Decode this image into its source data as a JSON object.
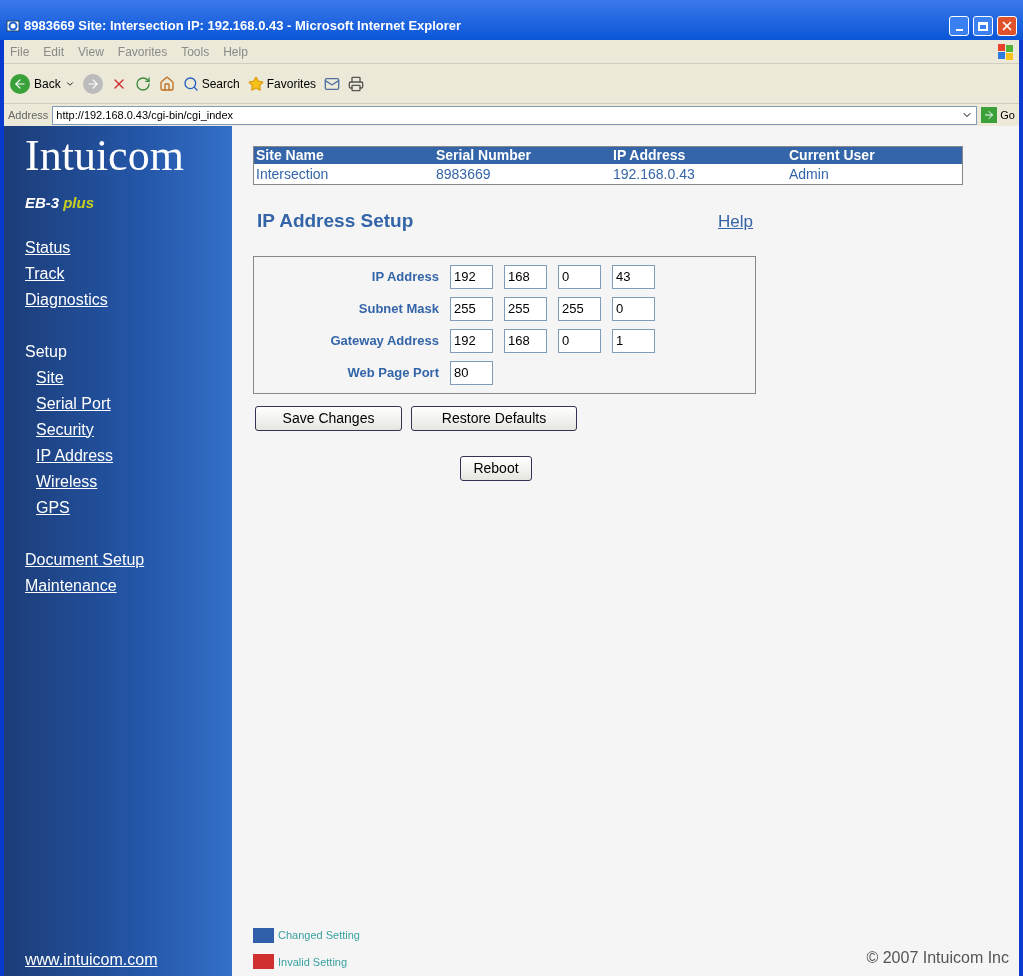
{
  "window": {
    "title": "8983669 Site: Intersection IP: 192.168.0.43 - Microsoft Internet Explorer"
  },
  "menu": [
    "File",
    "Edit",
    "View",
    "Favorites",
    "Tools",
    "Help"
  ],
  "toolbar": {
    "back": "Back",
    "search": "Search",
    "favorites": "Favorites"
  },
  "address_bar": {
    "label": "Address",
    "url": "http://192.168.0.43/cgi-bin/cgi_index",
    "go": "Go"
  },
  "sidebar": {
    "logo": "Intuicom",
    "model": "EB-3",
    "model_suffix": "plus",
    "nav": [
      {
        "label": "Status"
      },
      {
        "label": "Track"
      },
      {
        "label": "Diagnostics"
      },
      {
        "label": "Setup",
        "children": [
          {
            "label": "Site"
          },
          {
            "label": "Serial Port"
          },
          {
            "label": "Security"
          },
          {
            "label": "IP Address"
          },
          {
            "label": "Wireless"
          },
          {
            "label": "GPS"
          }
        ]
      },
      {
        "label": "Document Setup"
      },
      {
        "label": "Maintenance"
      }
    ],
    "footer_link": "www.intuicom.com"
  },
  "info_table": {
    "columns": [
      "Site Name",
      "Serial Number",
      "IP Address",
      "Current User"
    ],
    "row": [
      "Intersection",
      "8983669",
      "192.168.0.43",
      "Admin"
    ]
  },
  "page_title": "IP Address Setup",
  "help_link": "Help",
  "fields": [
    {
      "label": "IP Address",
      "values": [
        "192",
        "168",
        "0",
        "43"
      ]
    },
    {
      "label": "Subnet Mask",
      "values": [
        "255",
        "255",
        "255",
        "0"
      ]
    },
    {
      "label": "Gateway Address",
      "values": [
        "192",
        "168",
        "0",
        "1"
      ]
    },
    {
      "label": "Web Page Port",
      "values": [
        "80"
      ]
    }
  ],
  "buttons": [
    "Save Changes",
    "Restore Defaults"
  ],
  "reboot_button": "Reboot",
  "legend": [
    {
      "label": "Changed Setting",
      "color": "#2f5fa8"
    },
    {
      "label": "Invalid Setting",
      "color": "#d03030"
    }
  ],
  "copyright": "© 2007 Intuicom Inc"
}
